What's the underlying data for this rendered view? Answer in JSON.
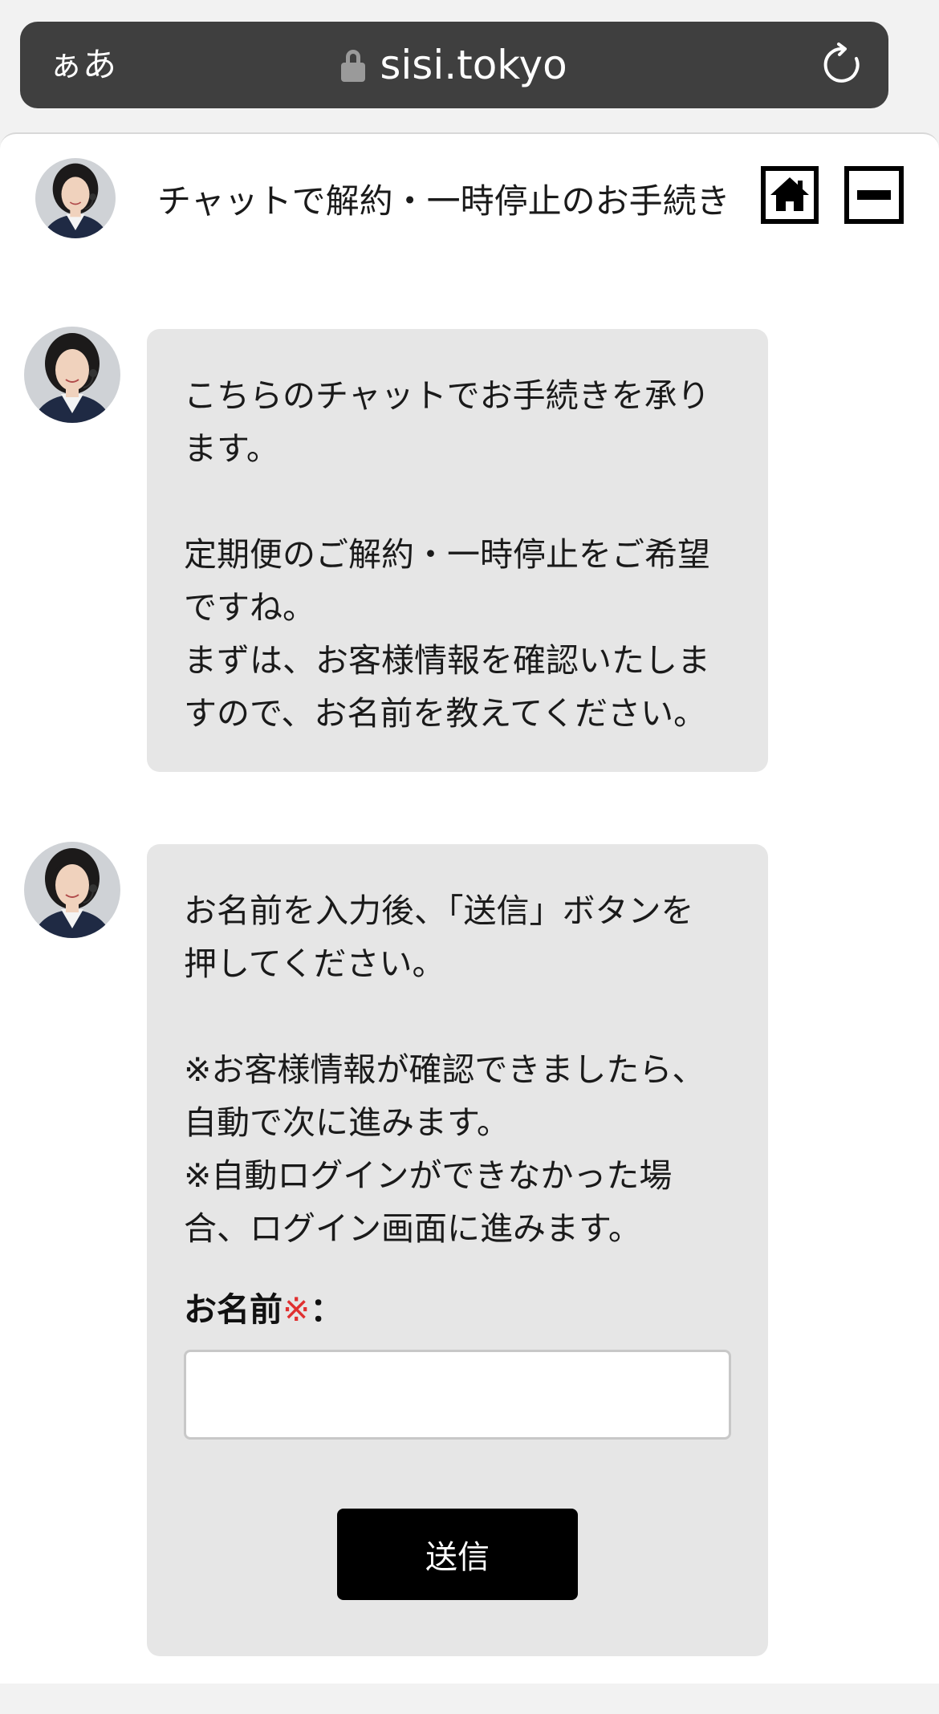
{
  "browser": {
    "text_size_label": "ぁあ",
    "url": "sisi.tokyo",
    "lock_icon": "lock-icon",
    "reload_icon": "reload-icon"
  },
  "header": {
    "title": "チャットで解約・一時停止のお手続き",
    "home_icon": "home-icon",
    "minimize_icon": "minimize-icon"
  },
  "messages": [
    {
      "text": "こちらのチャットでお手続きを承り\nます。\n\n定期便のご解約・一時停止をご希望\nですね。\nまずは、お客様情報を確認いたしま\nすので、お名前を教えてください。"
    },
    {
      "text": "お名前を入力後、「送信」ボタンを\n押してください。\n\n※お客様情報が確認できましたら、\n自動で次に進みます。\n※自動ログインができなかった場\n合、ログイン画面に進みます。",
      "form": {
        "label": "お名前",
        "required_mark": "※",
        "colon": "：",
        "input_value": "",
        "submit_label": "送信"
      }
    }
  ],
  "colors": {
    "browser_bar": "#3f3f3f",
    "bubble": "#e6e6e6",
    "required": "#e03030",
    "button": "#000000"
  }
}
